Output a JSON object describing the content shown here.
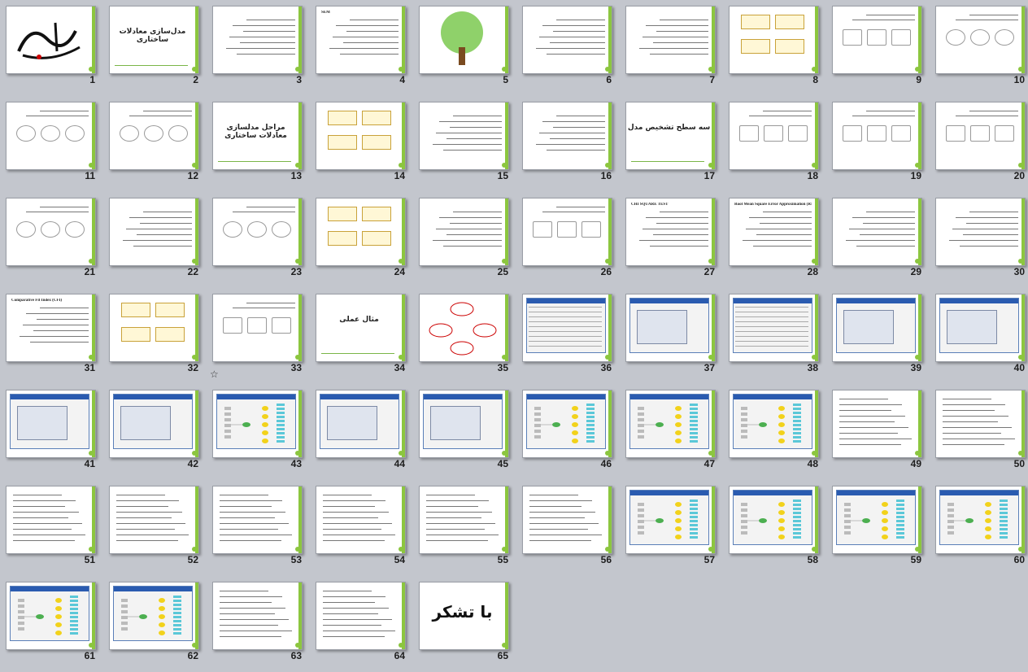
{
  "view": "slide-sorter",
  "colors": {
    "background": "#c3c6cd",
    "accent": "#8cc63f"
  },
  "slides": [
    {
      "n": "1",
      "kind": "calligraphy"
    },
    {
      "n": "2",
      "kind": "title",
      "text": "مدل‌سازی معادلات ساختاری"
    },
    {
      "n": "3",
      "kind": "text"
    },
    {
      "n": "4",
      "kind": "text",
      "text": "SEM"
    },
    {
      "n": "5",
      "kind": "tree"
    },
    {
      "n": "6",
      "kind": "text"
    },
    {
      "n": "7",
      "kind": "text"
    },
    {
      "n": "8",
      "kind": "boxes"
    },
    {
      "n": "9",
      "kind": "shapes"
    },
    {
      "n": "10",
      "kind": "diagram"
    },
    {
      "n": "11",
      "kind": "diagram"
    },
    {
      "n": "12",
      "kind": "diagram"
    },
    {
      "n": "13",
      "kind": "title",
      "text": "مراحل مدلسازی معادلات ساختاری"
    },
    {
      "n": "14",
      "kind": "boxes"
    },
    {
      "n": "15",
      "kind": "text"
    },
    {
      "n": "16",
      "kind": "text"
    },
    {
      "n": "17",
      "kind": "title",
      "text": "سه سطح تشخیص مدل"
    },
    {
      "n": "18",
      "kind": "equations"
    },
    {
      "n": "19",
      "kind": "equations"
    },
    {
      "n": "20",
      "kind": "equations"
    },
    {
      "n": "21",
      "kind": "diagram"
    },
    {
      "n": "22",
      "kind": "text"
    },
    {
      "n": "23",
      "kind": "diagram"
    },
    {
      "n": "24",
      "kind": "boxes"
    },
    {
      "n": "25",
      "kind": "text"
    },
    {
      "n": "26",
      "kind": "table"
    },
    {
      "n": "27",
      "kind": "text",
      "text": "CHI SQUARE TEST"
    },
    {
      "n": "28",
      "kind": "text",
      "text": "Root Mean Square Error Approximation (RMSEA)"
    },
    {
      "n": "29",
      "kind": "text"
    },
    {
      "n": "30",
      "kind": "text"
    },
    {
      "n": "31",
      "kind": "text",
      "text": "Comparative Fit Index (CFI)"
    },
    {
      "n": "32",
      "kind": "boxes"
    },
    {
      "n": "33",
      "kind": "scroll"
    },
    {
      "n": "34",
      "kind": "title",
      "text": "مثال عملی"
    },
    {
      "n": "35",
      "kind": "cycle"
    },
    {
      "n": "36",
      "kind": "spreadsheet"
    },
    {
      "n": "37",
      "kind": "window"
    },
    {
      "n": "38",
      "kind": "spreadsheet"
    },
    {
      "n": "39",
      "kind": "window"
    },
    {
      "n": "40",
      "kind": "window"
    },
    {
      "n": "41",
      "kind": "window"
    },
    {
      "n": "42",
      "kind": "window"
    },
    {
      "n": "43",
      "kind": "model"
    },
    {
      "n": "44",
      "kind": "window"
    },
    {
      "n": "45",
      "kind": "window"
    },
    {
      "n": "46",
      "kind": "model"
    },
    {
      "n": "47",
      "kind": "model"
    },
    {
      "n": "48",
      "kind": "model"
    },
    {
      "n": "49",
      "kind": "output"
    },
    {
      "n": "50",
      "kind": "output"
    },
    {
      "n": "51",
      "kind": "output"
    },
    {
      "n": "52",
      "kind": "output"
    },
    {
      "n": "53",
      "kind": "output"
    },
    {
      "n": "54",
      "kind": "output"
    },
    {
      "n": "55",
      "kind": "output"
    },
    {
      "n": "56",
      "kind": "output"
    },
    {
      "n": "57",
      "kind": "model"
    },
    {
      "n": "58",
      "kind": "model"
    },
    {
      "n": "59",
      "kind": "model"
    },
    {
      "n": "60",
      "kind": "model"
    },
    {
      "n": "61",
      "kind": "model"
    },
    {
      "n": "62",
      "kind": "model"
    },
    {
      "n": "63",
      "kind": "output"
    },
    {
      "n": "64",
      "kind": "output"
    },
    {
      "n": "65",
      "kind": "thanks",
      "text": "با تشکر"
    }
  ]
}
